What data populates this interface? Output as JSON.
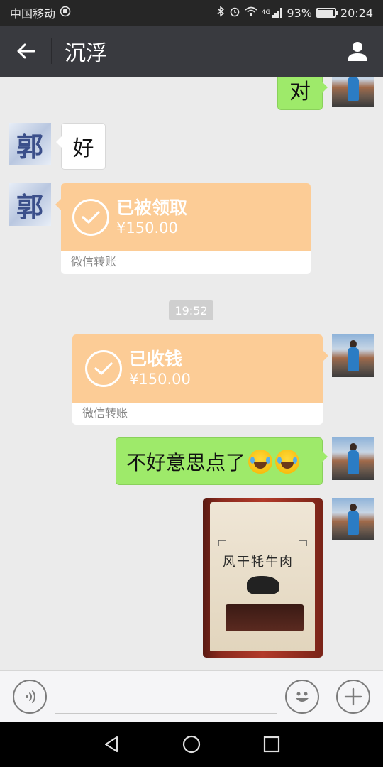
{
  "status_bar": {
    "carrier": "中国移动",
    "network": "4G",
    "battery": "93%",
    "battery_level": 0.93,
    "time": "20:24"
  },
  "header": {
    "title": "沉浮",
    "back_icon": "back-arrow-icon",
    "profile_icon": "person-icon"
  },
  "messages": {
    "m1": {
      "side": "right",
      "text": "对"
    },
    "m2": {
      "side": "left",
      "text": "好",
      "avatar_char": "郭"
    },
    "m3": {
      "side": "left",
      "type": "transfer",
      "status": "已被领取",
      "amount": "¥150.00",
      "label": "微信转账",
      "avatar_char": "郭"
    },
    "timestamp": "19:52",
    "m4": {
      "side": "right",
      "type": "transfer",
      "status": "已收钱",
      "amount": "¥150.00",
      "label": "微信转账"
    },
    "m5": {
      "side": "right",
      "text": "不好意思点了"
    },
    "m6": {
      "side": "right",
      "type": "image",
      "caption": "风干牦牛肉"
    }
  },
  "input_bar": {
    "voice_icon": "voice-icon",
    "emoji_icon": "emoji-icon",
    "plus_icon": "plus-icon"
  },
  "nav_bar": {
    "back": "triangle-back-icon",
    "home": "circle-home-icon",
    "recents": "square-recents-icon"
  }
}
